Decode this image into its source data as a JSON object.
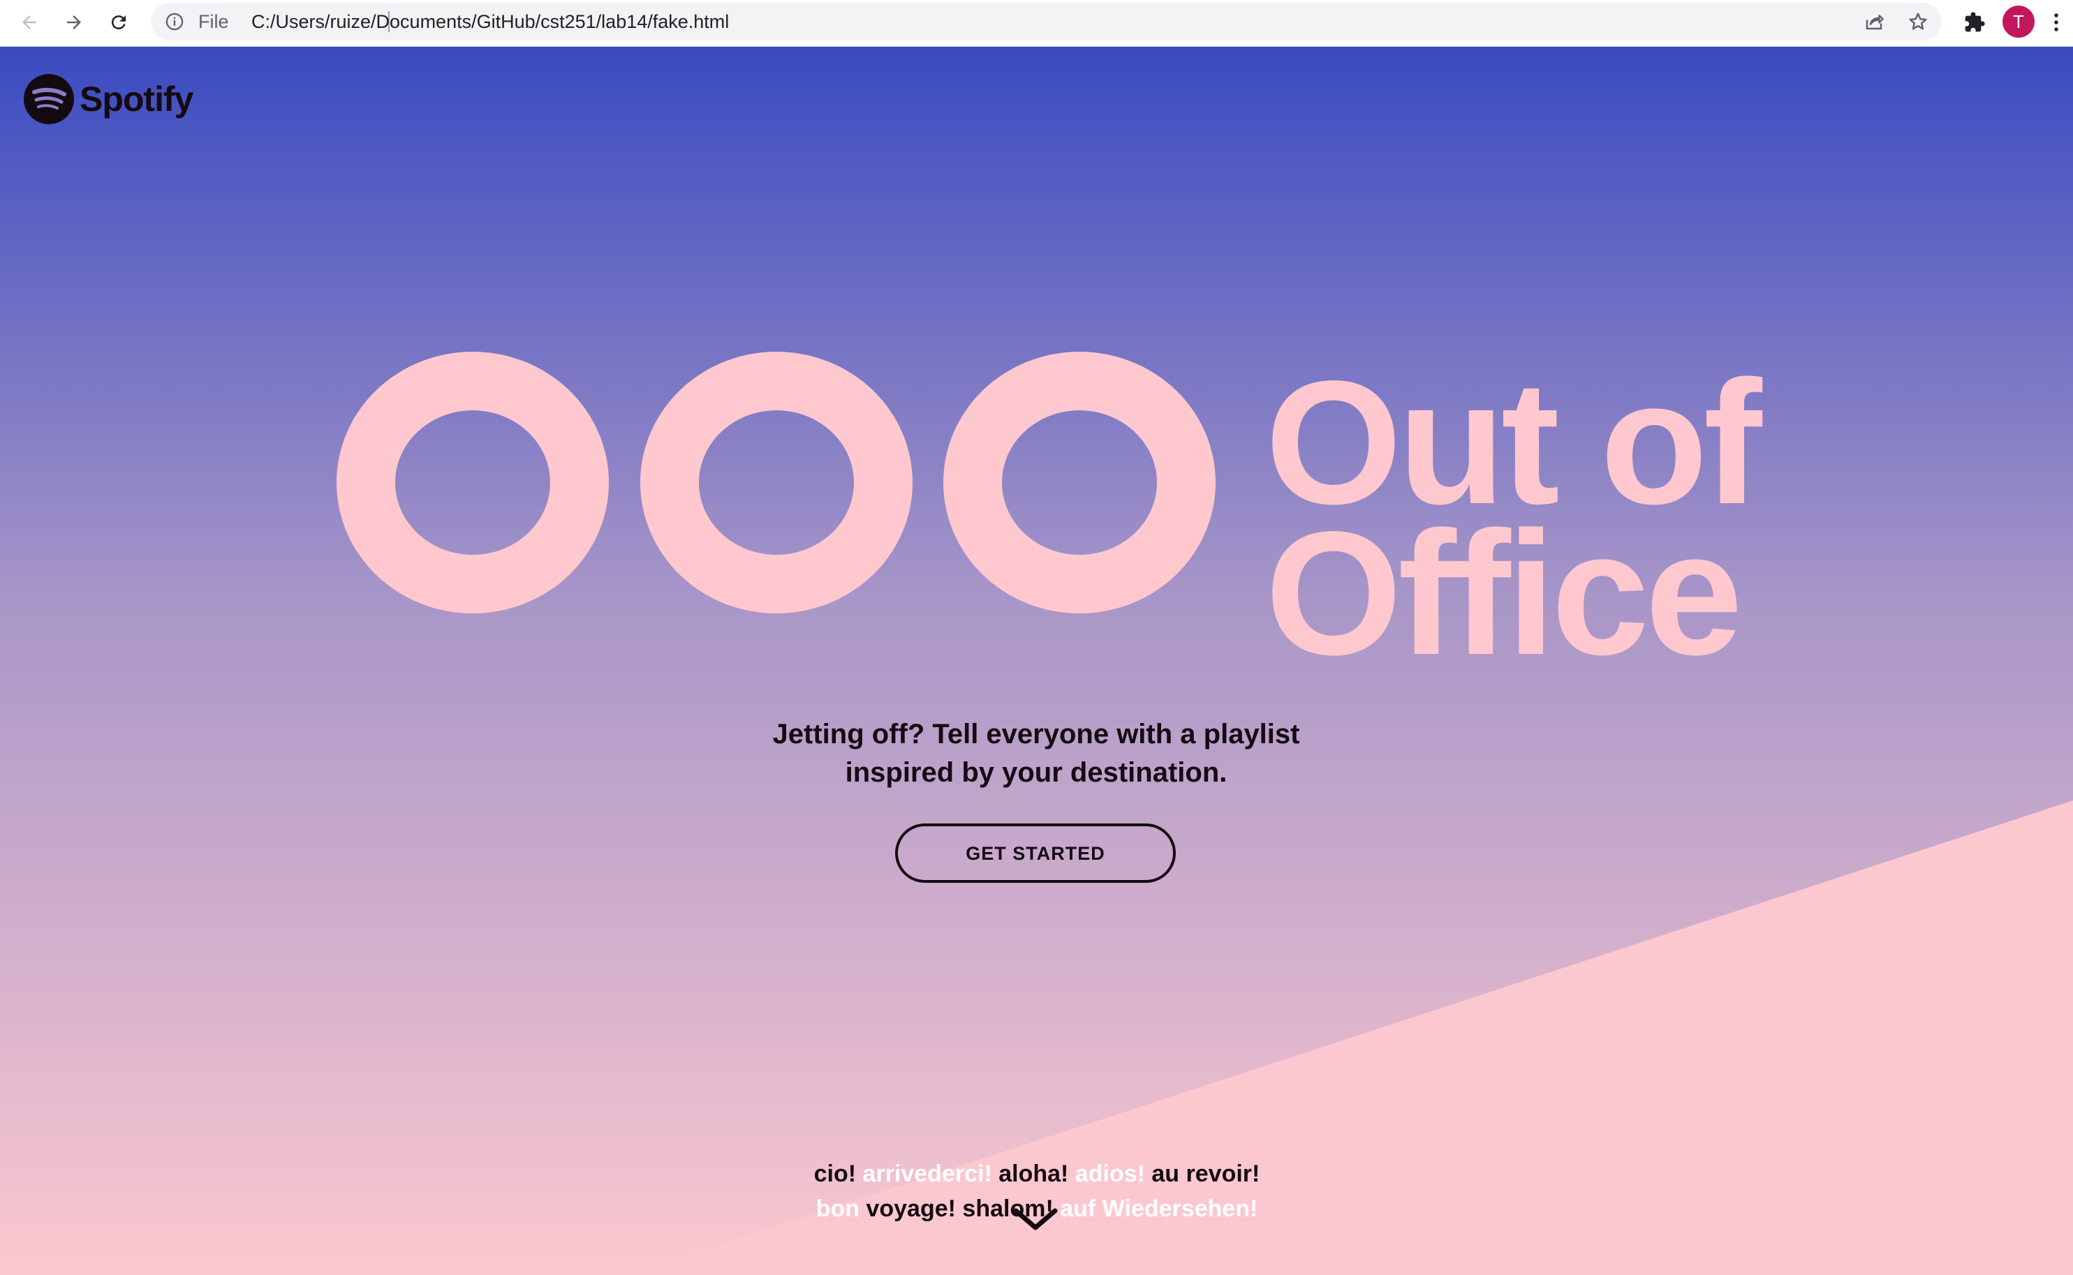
{
  "browser": {
    "url_scheme": "File",
    "url": "C:/Users/ruize/Documents/GitHub/cst251/lab14/fake.html",
    "profile_initial": "T",
    "profile_color": "#c2185b",
    "icons": [
      "back-arrow-icon",
      "forward-arrow-icon",
      "reload-icon",
      "info-icon",
      "share-icon",
      "star-icon",
      "extensions-puzzle-icon",
      "kebab-menu-icon"
    ]
  },
  "page": {
    "logo_text": "Spotify",
    "hero": {
      "ooo_letters": [
        "O",
        "O",
        "O"
      ],
      "title_line1": "Out of",
      "title_line2": "Office"
    },
    "tagline_line1": "Jetting off? Tell everyone with a playlist",
    "tagline_line2": "inspired by your destination.",
    "cta_label": "GET STARTED",
    "farewells": {
      "line1": [
        {
          "text": "cio!",
          "tone": "dark"
        },
        {
          "text": "arrivederci!",
          "tone": "light"
        },
        {
          "text": "aloha!",
          "tone": "dark"
        },
        {
          "text": "adios!",
          "tone": "light"
        },
        {
          "text": "au revoir!",
          "tone": "dark"
        }
      ],
      "line2": [
        {
          "text": "bon",
          "tone": "light"
        },
        {
          "text": "voyage!",
          "tone": "dark"
        },
        {
          "text": "shalom!",
          "tone": "dark"
        },
        {
          "text": "auf Wiedersehen!",
          "tone": "light"
        }
      ]
    },
    "colors": {
      "gradient_top": "#3a4bc0",
      "gradient_mid": "#a896c8",
      "gradient_bottom": "#fcc8cf",
      "accent_pink": "#ffc8cf",
      "text_dark": "#150a12"
    }
  }
}
